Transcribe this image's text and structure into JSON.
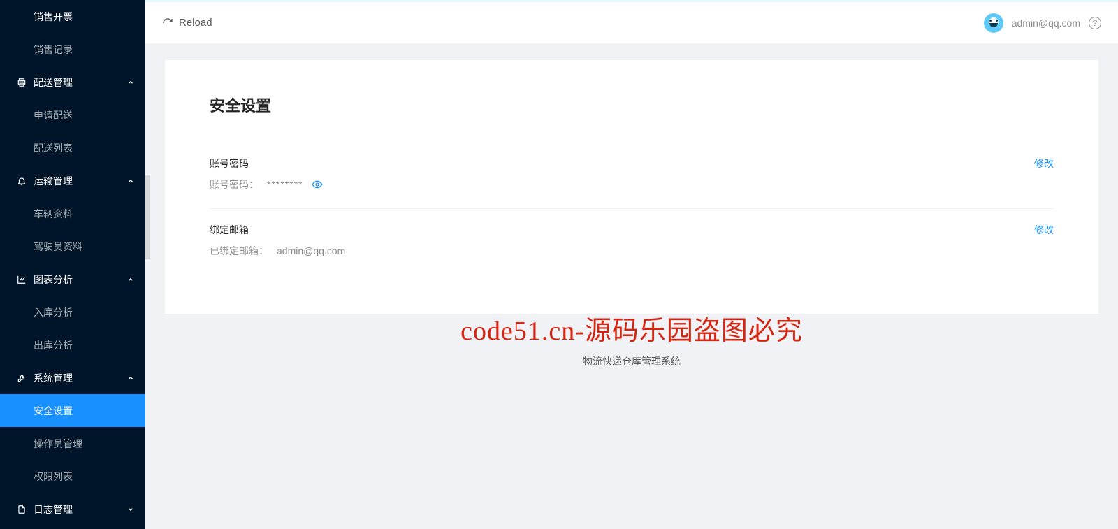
{
  "topbar": {
    "reload_label": "Reload",
    "user_email": "admin@qq.com"
  },
  "sidebar": {
    "groups": [
      {
        "label": null,
        "items": [
          {
            "label": "销售开票"
          },
          {
            "label": "销售记录"
          }
        ]
      },
      {
        "label": "配送管理",
        "items": [
          {
            "label": "申请配送"
          },
          {
            "label": "配送列表"
          }
        ]
      },
      {
        "label": "运输管理",
        "items": [
          {
            "label": "车辆资料"
          },
          {
            "label": "驾驶员资料"
          }
        ]
      },
      {
        "label": "图表分析",
        "items": [
          {
            "label": "入库分析"
          },
          {
            "label": "出库分析"
          }
        ]
      },
      {
        "label": "系统管理",
        "items": [
          {
            "label": "安全设置",
            "active": true
          },
          {
            "label": "操作员管理"
          },
          {
            "label": "权限列表"
          }
        ]
      },
      {
        "label": "日志管理",
        "items": []
      }
    ]
  },
  "page": {
    "title": "安全设置",
    "password_row": {
      "label": "账号密码",
      "desc_prefix": "账号密码：",
      "masked": "********",
      "action": "修改"
    },
    "email_row": {
      "label": "绑定邮箱",
      "desc_prefix": "已绑定邮箱：",
      "value": "admin@qq.com",
      "action": "修改"
    }
  },
  "footer": "物流快递仓库管理系统",
  "watermark": "code51.cn-源码乐园盗图必究"
}
